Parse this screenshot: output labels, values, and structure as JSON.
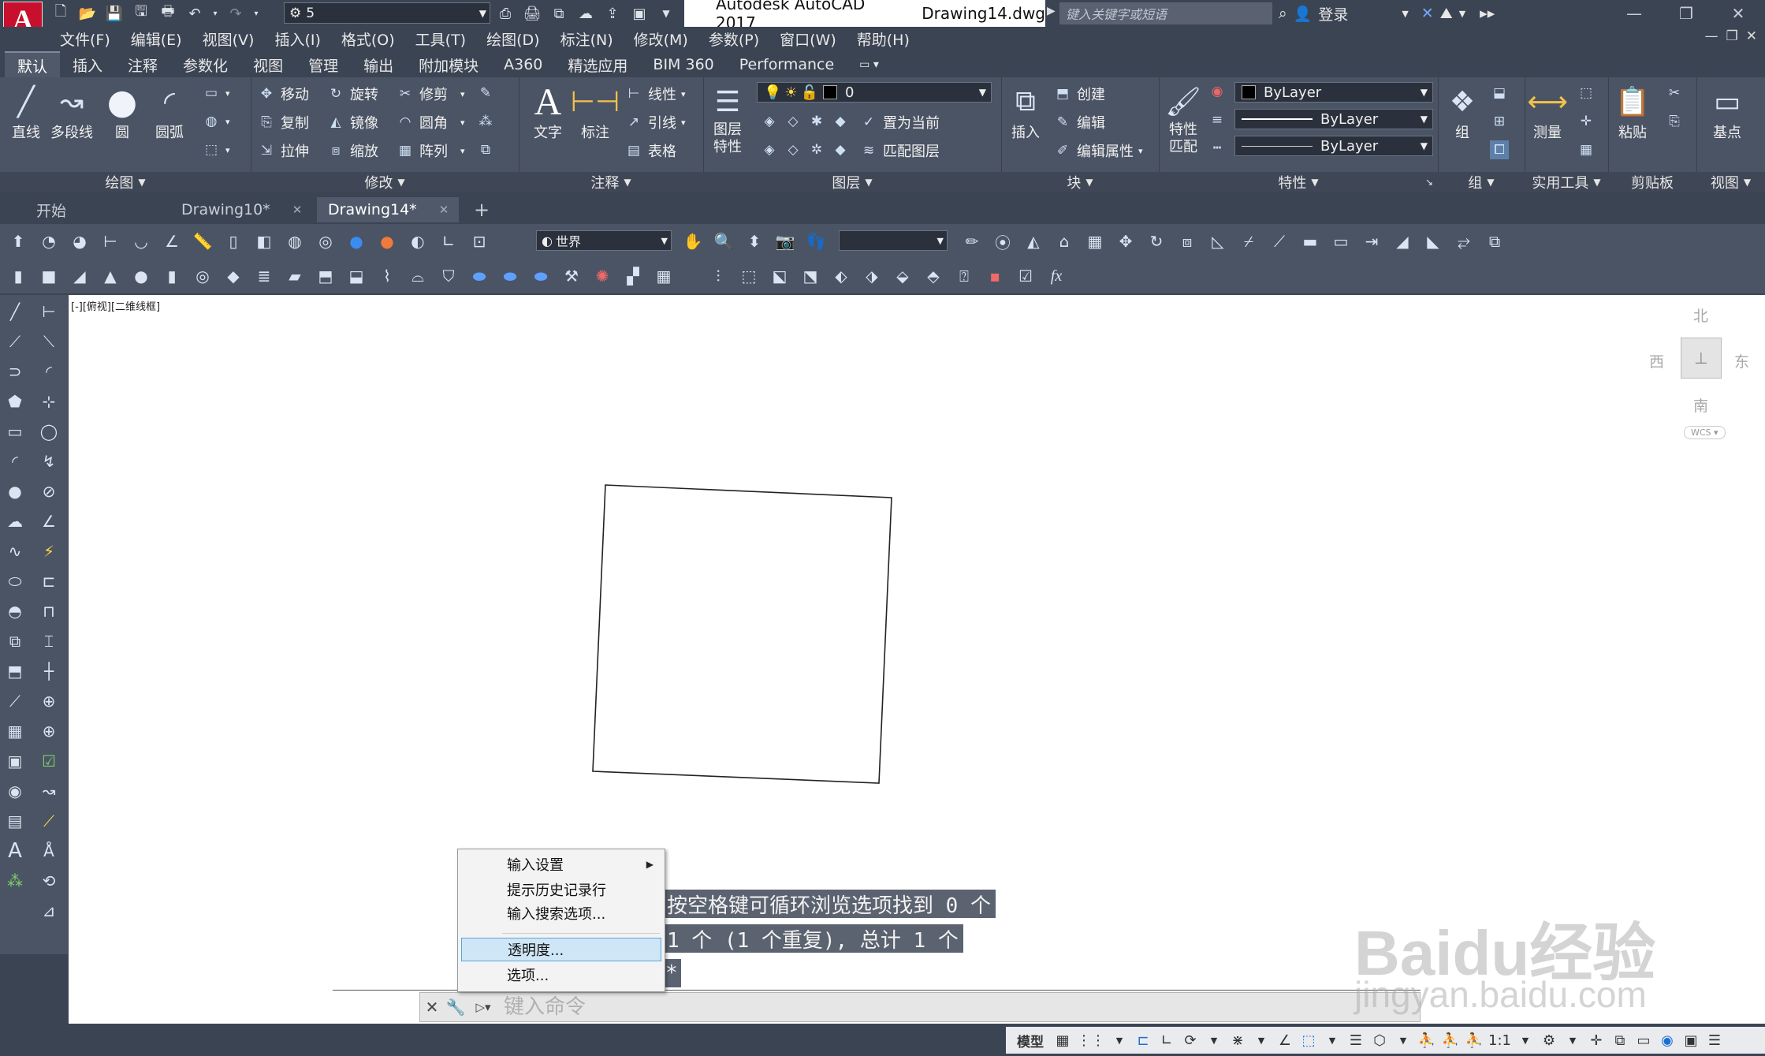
{
  "titlebar": {
    "app": "Autodesk AutoCAD 2017",
    "file": "Drawing14.dwg",
    "workspace": "5",
    "search_placeholder": "键入关键字或短语",
    "signin": "登录"
  },
  "menu": [
    "文件(F)",
    "编辑(E)",
    "视图(V)",
    "插入(I)",
    "格式(O)",
    "工具(T)",
    "绘图(D)",
    "标注(N)",
    "修改(M)",
    "参数(P)",
    "窗口(W)",
    "帮助(H)"
  ],
  "ribbon_tabs": [
    "默认",
    "插入",
    "注释",
    "参数化",
    "视图",
    "管理",
    "输出",
    "附加模块",
    "A360",
    "精选应用",
    "BIM 360",
    "Performance"
  ],
  "ribbon": {
    "draw": {
      "title": "绘图",
      "line": "直线",
      "polyline": "多段线",
      "circle": "圆",
      "arc": "圆弧"
    },
    "modify": {
      "title": "修改",
      "move": "移动",
      "rotate": "旋转",
      "trim": "修剪",
      "copy": "复制",
      "mirror": "镜像",
      "fillet": "圆角",
      "stretch": "拉伸",
      "scale": "缩放",
      "array": "阵列"
    },
    "annotation": {
      "title": "注释",
      "text": "文字",
      "dimension": "标注",
      "linear": "线性",
      "leader": "引线",
      "table": "表格"
    },
    "layers": {
      "title": "图层",
      "layer_props": "图层特性",
      "current_layer": "0",
      "set_current": "置为当前",
      "match_layer": "匹配图层"
    },
    "block": {
      "title": "块",
      "insert": "插入",
      "create": "创建",
      "edit": "编辑",
      "edit_attr": "编辑属性"
    },
    "properties": {
      "title": "特性",
      "match": "特性匹配",
      "color": "ByLayer",
      "linetype": "ByLayer",
      "lineweight": "ByLayer"
    },
    "groups": {
      "title": "组",
      "group": "组"
    },
    "utilities": {
      "title": "实用工具",
      "measure": "测量"
    },
    "clipboard": {
      "title": "剪贴板",
      "paste": "粘贴"
    },
    "view": {
      "title": "视图",
      "base": "基点"
    }
  },
  "file_tabs": [
    {
      "label": "开始"
    },
    {
      "label": "Drawing10*"
    },
    {
      "label": "Drawing14*"
    }
  ],
  "toolbar": {
    "ucs_select": "世界"
  },
  "viewport": {
    "label": "[-][俯视][二维线框]"
  },
  "viewcube": {
    "north": "北",
    "south": "南",
    "east": "东",
    "west": "西",
    "wcs": "WCS"
  },
  "command_history": [
    "按空格键可循环浏览选项找到 0 个",
    "1 个 (1 个重复), 总计 1 个",
    "*"
  ],
  "command_bar": {
    "placeholder": "键入命令"
  },
  "context_menu": {
    "items": [
      "输入设置",
      "提示历史记录行",
      "输入搜索选项...",
      "透明度...",
      "选项..."
    ]
  },
  "status": {
    "model": "模型",
    "scale": "1:1"
  },
  "watermark": {
    "brand": "Baidu经验",
    "url": "jingyan.baidu.com"
  },
  "colors": {
    "app_bg": "#3b4453",
    "ribbon_bg": "#4b5464",
    "canvas": "#ffffff",
    "highlight": "#cfe6f6",
    "logo_red": "#c8102e"
  }
}
